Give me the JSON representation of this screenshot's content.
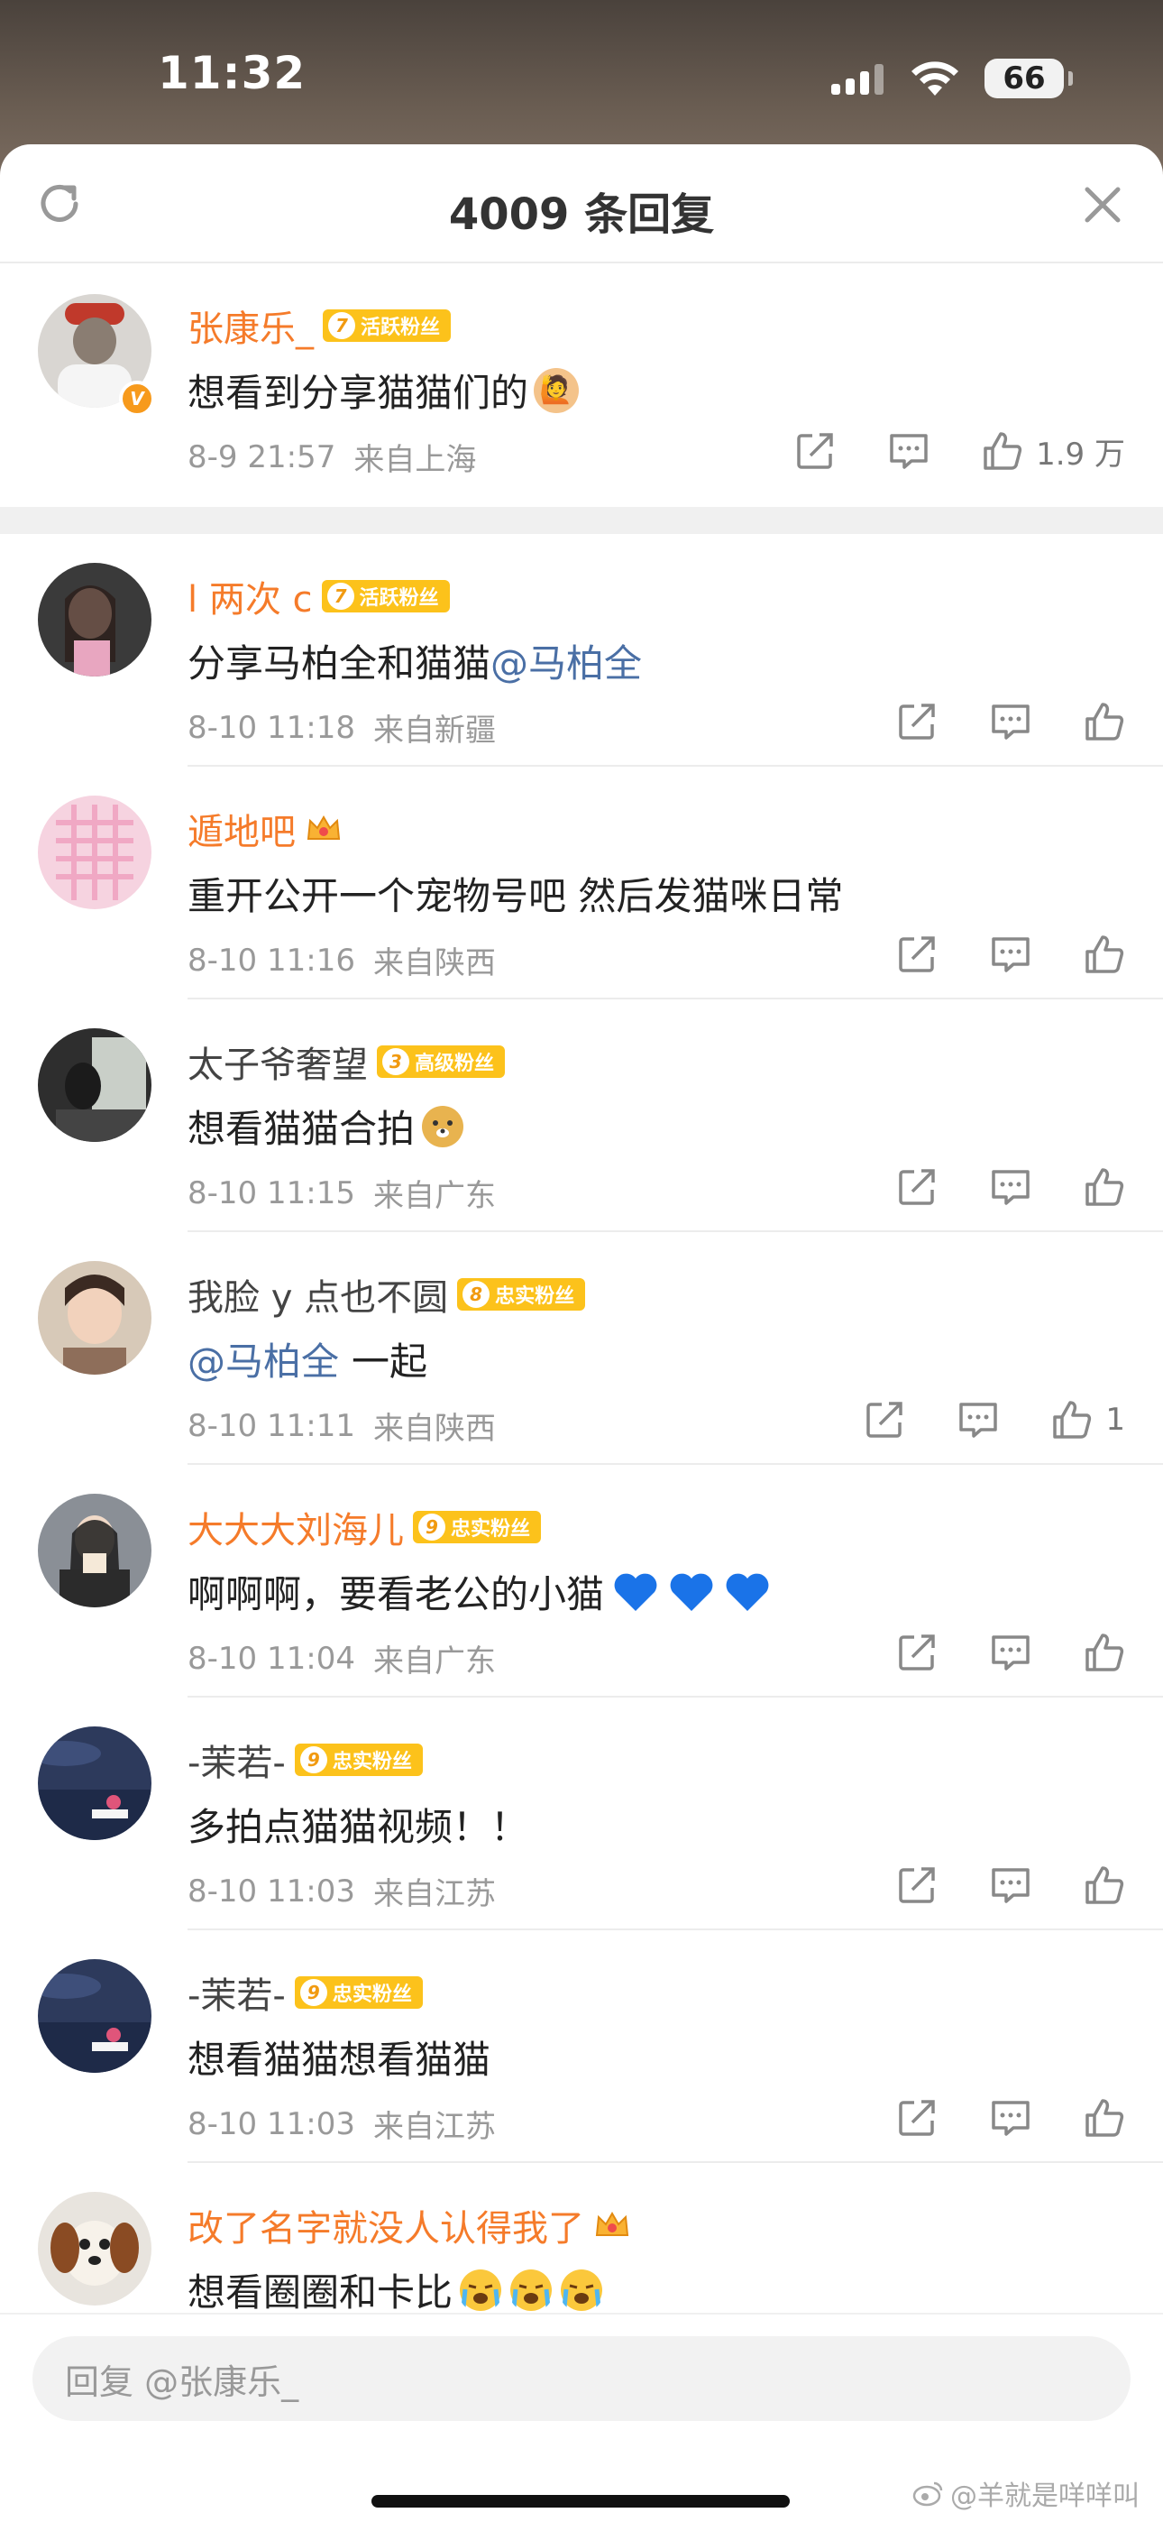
{
  "status_bar": {
    "time": "11:32",
    "battery": "66"
  },
  "header": {
    "title": "4009 条回复"
  },
  "comments": [
    {
      "username": "张康乐_",
      "badge_level": "7",
      "badge_text": "活跃粉丝",
      "text": "想看到分享猫猫们的",
      "date": "8-9 21:57",
      "location": "来自上海",
      "likes": "1.9 万",
      "verified": "V"
    },
    {
      "username": "l 两次 c",
      "badge_level": "7",
      "badge_text": "活跃粉丝",
      "text": "分享马柏全和猫猫",
      "mention": "@马柏全",
      "date": "8-10 11:18",
      "location": "来自新疆",
      "likes": ""
    },
    {
      "username": "遁地吧",
      "text": "重开公开一个宠物号吧 然后发猫咪日常",
      "date": "8-10 11:16",
      "location": "来自陕西",
      "likes": ""
    },
    {
      "username": "太子爷奢望",
      "badge_level": "3",
      "badge_text": "高级粉丝",
      "text": "想看猫猫合拍",
      "date": "8-10 11:15",
      "location": "来自广东",
      "likes": ""
    },
    {
      "username": "我脸 y 点也不圆",
      "badge_level": "8",
      "badge_text": "忠实粉丝",
      "mention": "@马柏全",
      "text": "一起",
      "date": "8-10 11:11",
      "location": "来自陕西",
      "likes": "1"
    },
    {
      "username": "大大大刘海儿",
      "badge_level": "9",
      "badge_text": "忠实粉丝",
      "text": "啊啊啊，要看老公的小猫",
      "date": "8-10 11:04",
      "location": "来自广东",
      "likes": ""
    },
    {
      "username": "-茉若-",
      "badge_level": "9",
      "badge_text": "忠实粉丝",
      "text": "多拍点猫猫视频！！",
      "date": "8-10 11:03",
      "location": "来自江苏",
      "likes": ""
    },
    {
      "username": "-茉若-",
      "badge_level": "9",
      "badge_text": "忠实粉丝",
      "text": "想看猫猫想看猫猫",
      "date": "8-10 11:03",
      "location": "来自江苏",
      "likes": ""
    },
    {
      "username": "改了名字就没人认得我了",
      "text": "想看圈圈和卡比",
      "date": "",
      "location": "",
      "likes": ""
    }
  ],
  "reply": {
    "placeholder": "回复 @张康乐_"
  },
  "watermark": "@羊就是咩咩叫",
  "colors": {
    "accent_orange": "#f57b2a",
    "mention_blue": "#4a6fa5",
    "badge_gold": "#fcc21b",
    "heart_blue": "#1a73e8"
  }
}
